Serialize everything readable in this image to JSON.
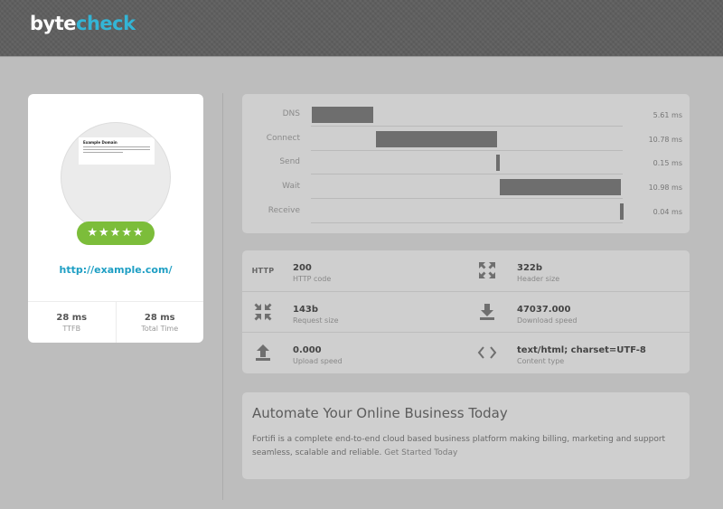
{
  "header": {
    "logo_part1": "byte",
    "logo_part2": "check",
    "accent_color": "#33b5d6"
  },
  "card": {
    "thumbnail": {
      "title": "Example Domain"
    },
    "rating_stars": "★★★★★",
    "rating": 5,
    "site_url": "http://example.com/",
    "stats": [
      {
        "value": "28 ms",
        "label": "TTFB"
      },
      {
        "value": "28 ms",
        "label": "Total Time"
      }
    ]
  },
  "timing": {
    "rows": [
      {
        "label": "DNS",
        "value": "5.61 ms"
      },
      {
        "label": "Connect",
        "value": "10.78 ms"
      },
      {
        "label": "Send",
        "value": "0.15 ms"
      },
      {
        "label": "Wait",
        "value": "10.98 ms"
      },
      {
        "label": "Receive",
        "value": "0.04 ms"
      }
    ]
  },
  "info": {
    "items": [
      {
        "icon": "HTTP",
        "value": "200",
        "label": "HTTP code"
      },
      {
        "icon": "expand-icon",
        "value": "322b",
        "label": "Header size"
      },
      {
        "icon": "compress-icon",
        "value": "143b",
        "label": "Request size"
      },
      {
        "icon": "download-icon",
        "value": "47037.000",
        "label": "Download speed"
      },
      {
        "icon": "upload-icon",
        "value": "0.000",
        "label": "Upload speed"
      },
      {
        "icon": "code-icon",
        "value": "text/html; charset=UTF-8",
        "label": "Content type"
      }
    ]
  },
  "ad": {
    "title": "Automate Your Online Business Today",
    "body": "Fortifi is a complete end-to-end cloud based business platform making billing, marketing and support seamless, scalable and reliable.",
    "cta": "Get Started Today"
  }
}
